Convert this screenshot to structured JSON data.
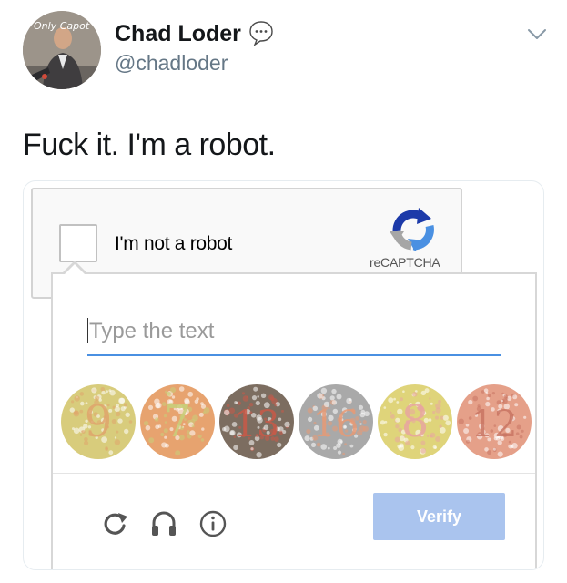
{
  "author": {
    "display_name": "Chad Loder",
    "handle": "@chadloder",
    "avatar_text": "Only Capot"
  },
  "tweet": {
    "text": "Fuck it. I'm a robot."
  },
  "icons": {
    "reply_badge": "speech-bubble-icon",
    "menu": "chevron-down-icon",
    "refresh": "refresh-icon",
    "audio": "headphones-icon",
    "info": "info-icon",
    "brand": "recaptcha-logo-icon"
  },
  "recaptcha": {
    "checkbox_label": "I'm not a robot",
    "checked": false,
    "brand_name": "reCAPTCHA"
  },
  "challenge": {
    "input_placeholder": "Type the text",
    "input_value": "",
    "plates": [
      {
        "number": "9",
        "background": "#d8cc7c",
        "digit_color": "#e0a56c"
      },
      {
        "number": "7",
        "background": "#e7a36f",
        "digit_color": "#c9cf7a"
      },
      {
        "number": "13",
        "background": "#7c6d60",
        "digit_color": "#c95a48"
      },
      {
        "number": "16",
        "background": "#a9a9a9",
        "digit_color": "#e79a76"
      },
      {
        "number": "8",
        "background": "#dfd47a",
        "digit_color": "#e8a6a0"
      },
      {
        "number": "12",
        "background": "#e5a089",
        "digit_color": "#c97563"
      }
    ],
    "verify_label": "Verify"
  },
  "colors": {
    "verify_button": "#aac4ee",
    "input_underline": "#4a90e2",
    "handle_text": "#657786"
  }
}
